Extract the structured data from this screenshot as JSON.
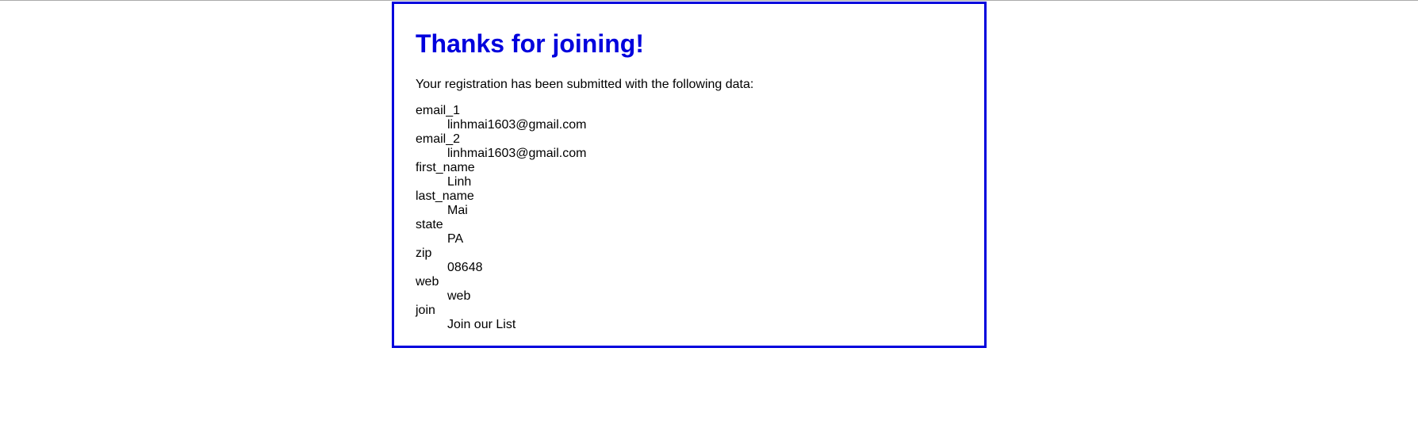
{
  "page": {
    "title": "Thanks for joining!",
    "intro": "Your registration has been submitted with the following data:"
  },
  "fields": [
    {
      "name": "email_1",
      "value": "linhmai1603@gmail.com"
    },
    {
      "name": "email_2",
      "value": "linhmai1603@gmail.com"
    },
    {
      "name": "first_name",
      "value": "Linh"
    },
    {
      "name": "last_name",
      "value": "Mai"
    },
    {
      "name": "state",
      "value": "PA"
    },
    {
      "name": "zip",
      "value": "08648"
    },
    {
      "name": "web",
      "value": "web"
    },
    {
      "name": "join",
      "value": "Join our List"
    }
  ],
  "colors": {
    "accent": "#0000dd",
    "text": "#000000",
    "background": "#ffffff"
  }
}
